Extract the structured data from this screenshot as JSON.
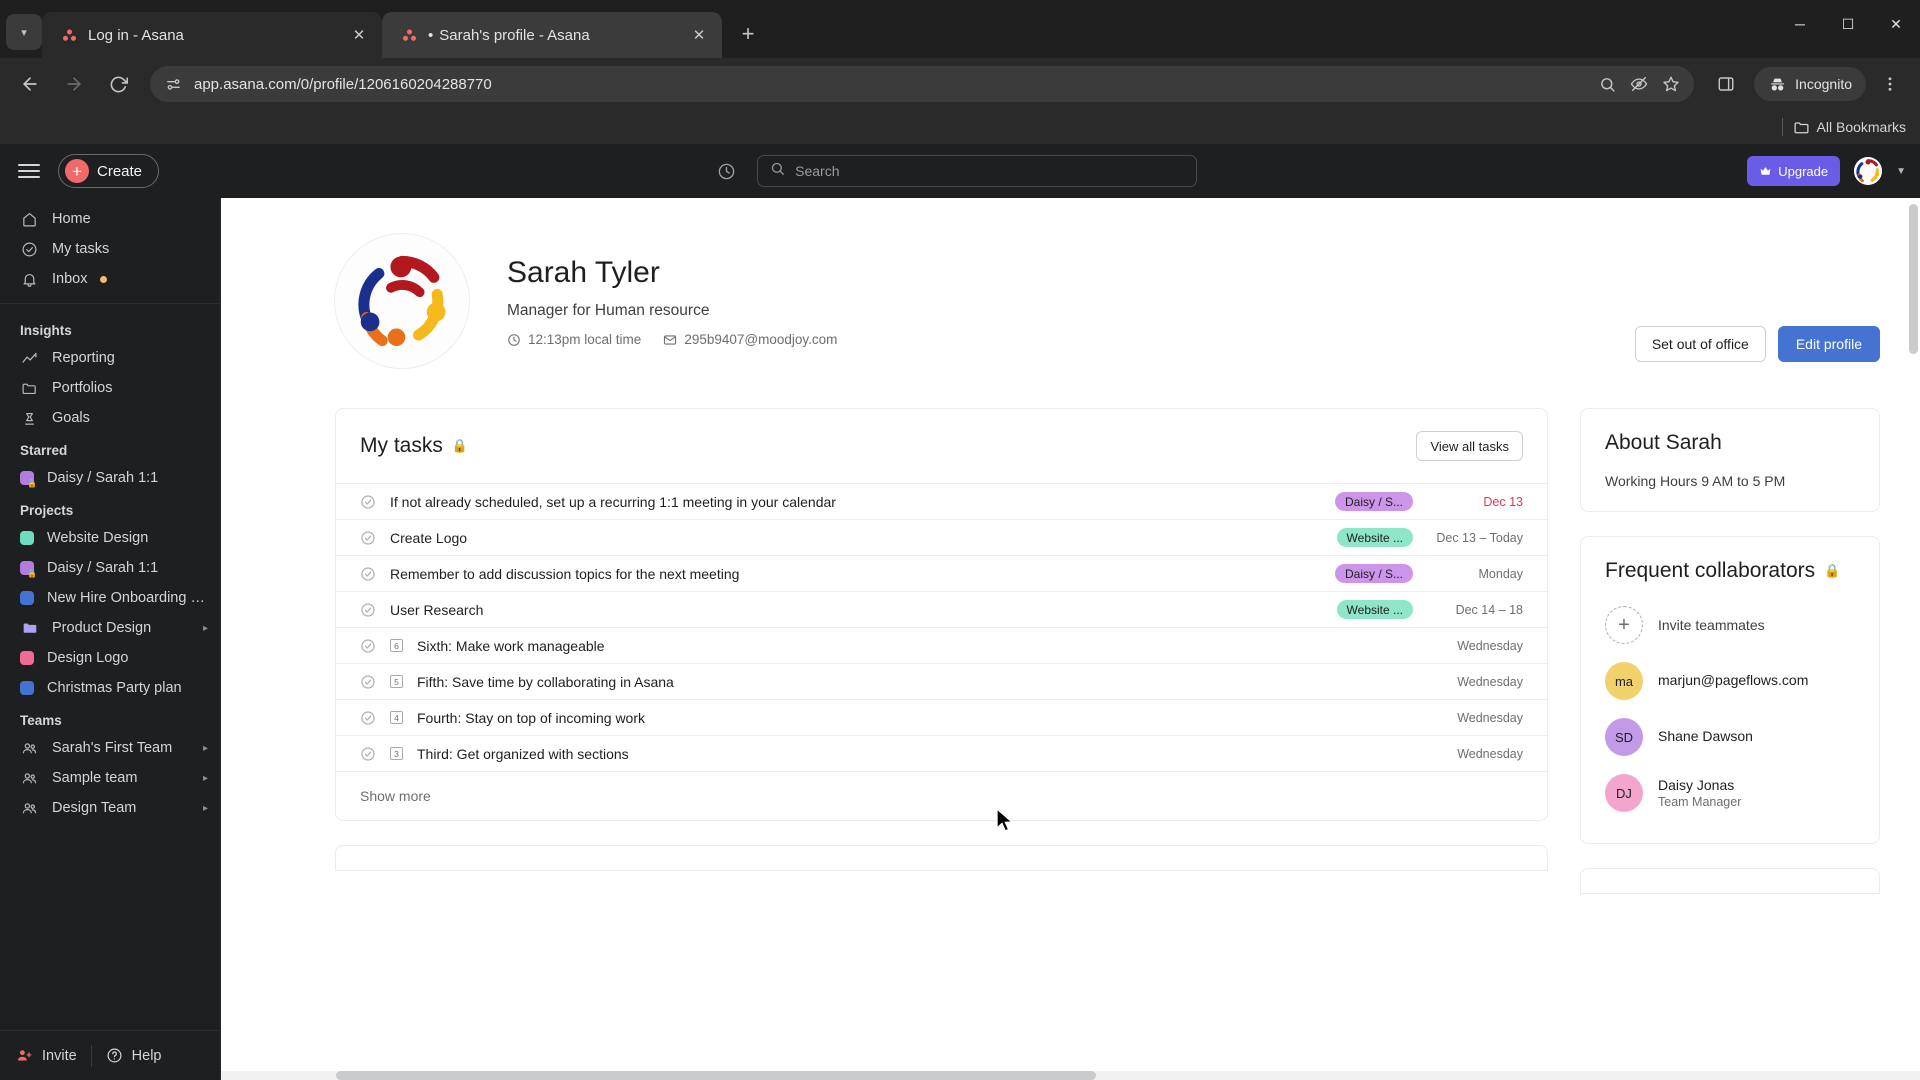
{
  "browser": {
    "tabs": [
      {
        "title": "Log in - Asana",
        "active": false,
        "modified": false
      },
      {
        "title": "Sarah's profile - Asana",
        "active": true,
        "modified": true
      }
    ],
    "tab_close_label": "✕",
    "new_tab_label": "+",
    "url": "app.asana.com/0/profile/1206160204288770",
    "incognito_label": "Incognito",
    "bookmarks_label": "All Bookmarks",
    "window_controls": {
      "minimize": "─",
      "maximize": "☐",
      "close": "✕"
    },
    "nav": {
      "back": "back-arrow",
      "forward": "forward-arrow",
      "reload": "reload-arrow"
    }
  },
  "topbar": {
    "create_label": "Create",
    "search_placeholder": "Search",
    "upgrade_label": "Upgrade"
  },
  "sidebar": {
    "nav": [
      {
        "label": "Home",
        "icon": "home-icon"
      },
      {
        "label": "My tasks",
        "icon": "check-circle-icon"
      },
      {
        "label": "Inbox",
        "icon": "bell-icon",
        "badge_dot": true
      }
    ],
    "insights_header": "Insights",
    "insights": [
      {
        "label": "Reporting",
        "icon": "chart-line-icon"
      },
      {
        "label": "Portfolios",
        "icon": "folder-icon"
      },
      {
        "label": "Goals",
        "icon": "goal-icon"
      }
    ],
    "starred_header": "Starred",
    "starred": [
      {
        "label": "Daisy / Sarah 1:1",
        "color": "#b57ce0",
        "locked": true
      }
    ],
    "projects_header": "Projects",
    "projects": [
      {
        "label": "Website Design",
        "color": "#6fdcc0",
        "locked": false,
        "chevron": false
      },
      {
        "label": "Daisy / Sarah 1:1",
        "color": "#b57ce0",
        "locked": true,
        "chevron": false
      },
      {
        "label": "New Hire Onboarding Ch...",
        "color": "#4573d2",
        "locked": false,
        "chevron": false
      },
      {
        "label": "Product Design",
        "color": "#aea1f1",
        "locked": false,
        "chevron": true,
        "is_folder": true
      },
      {
        "label": "Design Logo",
        "color": "#f06a96",
        "locked": false,
        "chevron": false
      },
      {
        "label": "Christmas Party plan",
        "color": "#4573d2",
        "locked": false,
        "chevron": false
      }
    ],
    "teams_header": "Teams",
    "teams": [
      {
        "label": "Sarah's First Team",
        "icon": "team-icon",
        "chevron": true
      },
      {
        "label": "Sample team",
        "icon": "team-icon",
        "chevron": true
      },
      {
        "label": "Design Team",
        "icon": "team-icon",
        "chevron": true
      }
    ],
    "footer": {
      "invite_label": "Invite",
      "help_label": "Help"
    }
  },
  "profile": {
    "name": "Sarah Tyler",
    "role": "Manager for Human resource",
    "local_time": "12:13pm local time",
    "email": "295b9407@moodjoy.com",
    "set_out_of_office": "Set out of office",
    "edit_profile": "Edit profile"
  },
  "my_tasks": {
    "title": "My tasks",
    "view_all_label": "View all tasks",
    "show_more_label": "Show more",
    "rows": [
      {
        "name": "If not already scheduled, set up a recurring 1:1 meeting in your calendar",
        "pill": "Daisy / S...",
        "pill_color": "#cd95ea",
        "date": "Dec 13",
        "due": true,
        "num": null
      },
      {
        "name": "Create Logo",
        "pill": "Website ...",
        "pill_color": "#8ee5c8",
        "date": "Dec 13 – Today",
        "due": false,
        "num": null
      },
      {
        "name": "Remember to add discussion topics for the next meeting",
        "pill": "Daisy / S...",
        "pill_color": "#cd95ea",
        "date": "Monday",
        "due": false,
        "num": null
      },
      {
        "name": "User Research",
        "pill": "Website ...",
        "pill_color": "#8ee5c8",
        "date": "Dec 14 – 18",
        "due": false,
        "num": null
      },
      {
        "name": "Sixth: Make work manageable",
        "pill": null,
        "pill_color": null,
        "date": "Wednesday",
        "due": false,
        "num": "6"
      },
      {
        "name": "Fifth: Save time by collaborating in Asana",
        "pill": null,
        "pill_color": null,
        "date": "Wednesday",
        "due": false,
        "num": "5"
      },
      {
        "name": "Fourth: Stay on top of incoming work",
        "pill": null,
        "pill_color": null,
        "date": "Wednesday",
        "due": false,
        "num": "4"
      },
      {
        "name": "Third: Get organized with sections",
        "pill": null,
        "pill_color": null,
        "date": "Wednesday",
        "due": false,
        "num": "3"
      }
    ]
  },
  "about": {
    "title": "About Sarah",
    "working_hours": "Working Hours 9 AM to 5 PM"
  },
  "collaborators": {
    "title": "Frequent collaborators",
    "invite_label": "Invite teammates",
    "people": [
      {
        "name": "marjun@pageflows.com",
        "initials": "ma",
        "color": "#f1d16c",
        "subtitle": null
      },
      {
        "name": "Shane Dawson",
        "initials": "SD",
        "color": "#c39ae8",
        "subtitle": null
      },
      {
        "name": "Daisy Jonas",
        "initials": "DJ",
        "color": "#f3a5cb",
        "subtitle": "Team Manager"
      }
    ]
  }
}
